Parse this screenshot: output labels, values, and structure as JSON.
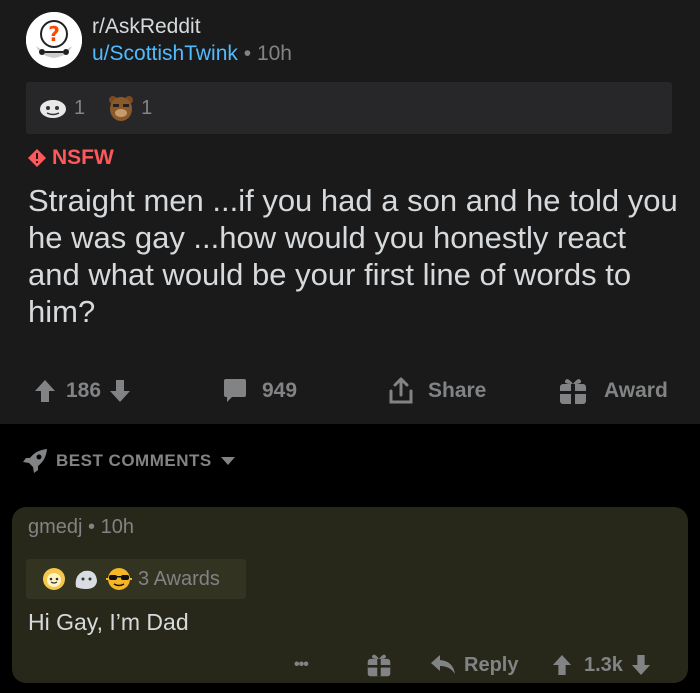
{
  "post": {
    "subreddit": "r/AskReddit",
    "author": "u/ScottishTwink",
    "separator": "•",
    "age": "10h",
    "awards": [
      {
        "icon": "silver-award-icon",
        "count": "1"
      },
      {
        "icon": "bear-award-icon",
        "count": "1"
      }
    ],
    "nsfw_label": "NSFW",
    "title": "Straight men ...if you had a son and he told you he was gay ...how would you honestly react and what would be your first line of words to him?",
    "vote_count": "186",
    "comment_count": "949",
    "share_label": "Share",
    "award_label": "Award"
  },
  "sort": {
    "label": "BEST COMMENTS"
  },
  "comment": {
    "author": "gmedj",
    "separator": "•",
    "age": "10h",
    "awards_label": "3 Awards",
    "body": "Hi Gay, I’m Dad",
    "more": "•••",
    "reply_label": "Reply",
    "vote_count": "1.3k"
  },
  "colors": {
    "background": "#000000",
    "post_bg": "#1a1a1b",
    "comment_bg": "#28281a",
    "username": "#4fbcff",
    "nsfw": "#ff585b",
    "muted": "#818384",
    "text": "#d7dadc"
  }
}
